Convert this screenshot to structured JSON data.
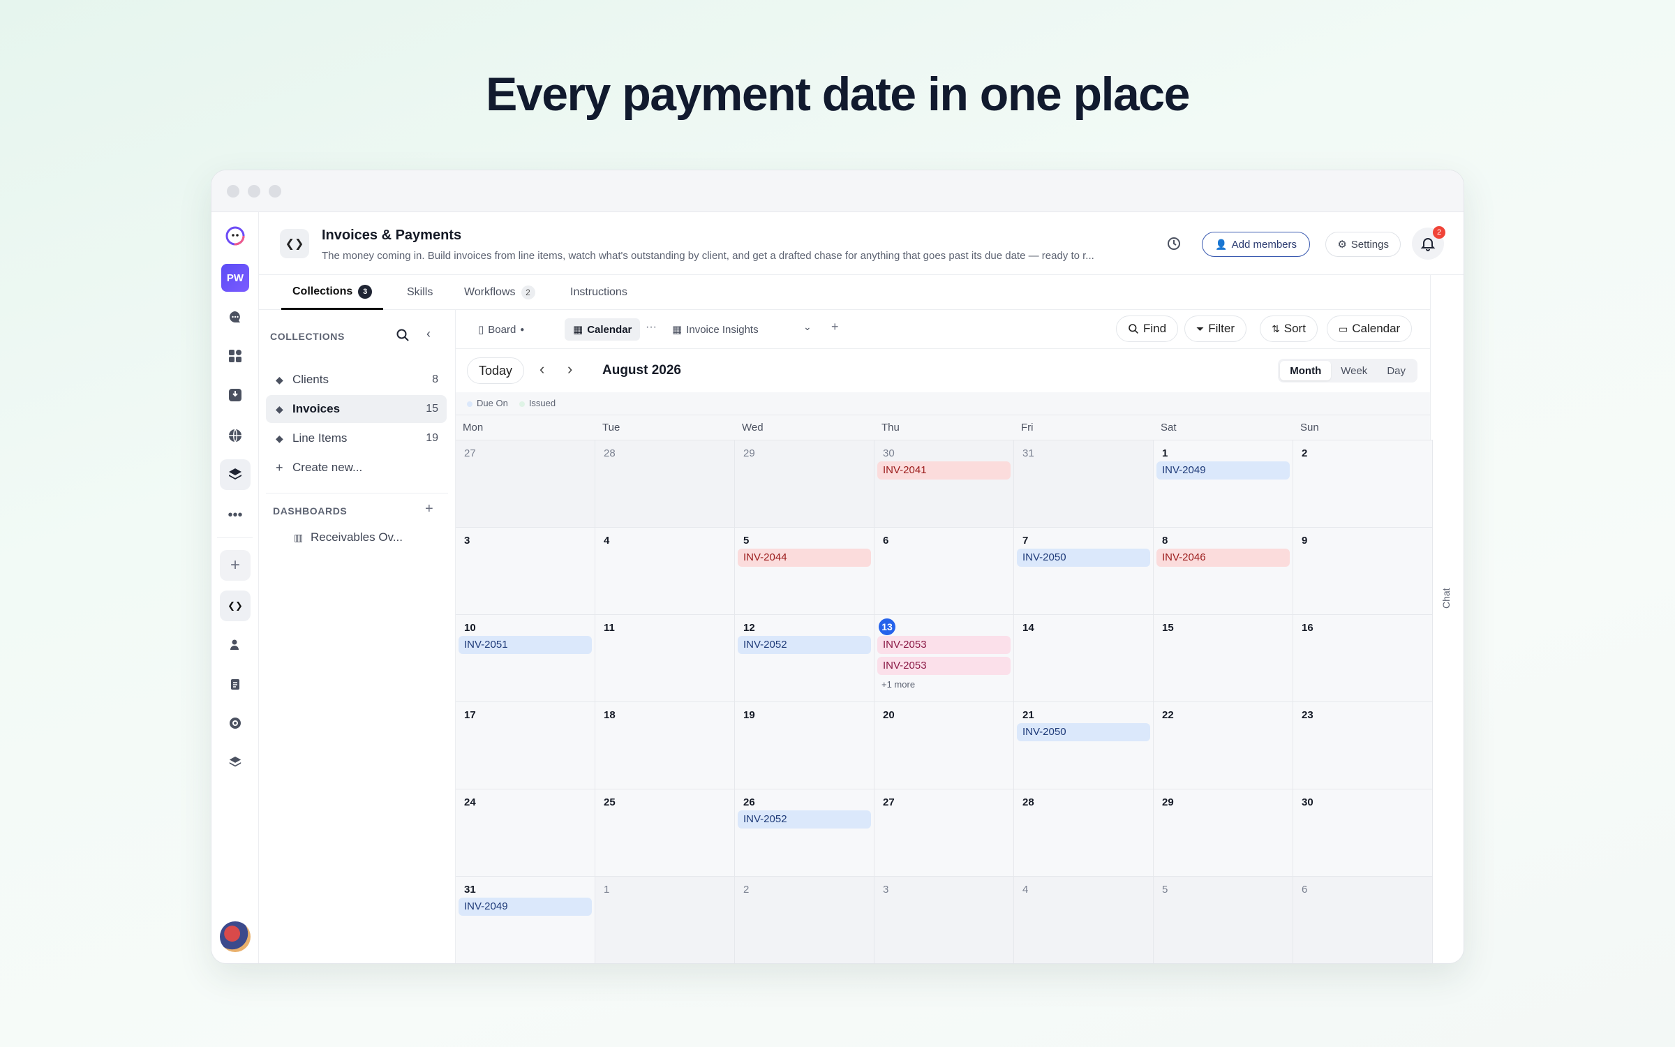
{
  "headline": "Every payment date in one place",
  "app": {
    "title": "Invoices & Payments",
    "description": "The money coming in. Build invoices from line items, watch what's outstanding by client, and get a drafted chase for anything that goes past its due date — ready to r...",
    "workspace_initials": "PW",
    "add_members": "Add members",
    "settings": "Settings",
    "notifications_count": "2",
    "app_icon_glyph": "❮❯"
  },
  "tabs": [
    {
      "label": "Collections",
      "count": "3"
    },
    {
      "label": "Skills"
    },
    {
      "label": "Workflows",
      "count": "2"
    },
    {
      "label": "Instructions"
    }
  ],
  "chat_label": "Chat",
  "panel": {
    "collections_heading": "COLLECTIONS",
    "items": [
      {
        "label": "Clients",
        "count": "8"
      },
      {
        "label": "Invoices",
        "count": "15"
      },
      {
        "label": "Line Items",
        "count": "19"
      }
    ],
    "create_new": "Create new...",
    "dashboards_heading": "DASHBOARDS",
    "dashboard_item": "Receivables Ov..."
  },
  "views": {
    "board": "Board",
    "calendar": "Calendar",
    "insights": "Invoice Insights",
    "find": "Find",
    "filter": "Filter",
    "sort": "Sort",
    "calendar_btn": "Calendar"
  },
  "calendar": {
    "today_label": "Today",
    "month_label": "August 2026",
    "modes": [
      "Month",
      "Week",
      "Day"
    ],
    "active_mode": "Month",
    "legend": [
      {
        "label": "Due On",
        "color": "#dbe8fb"
      },
      {
        "label": "Issued",
        "color": "#dff3e6"
      }
    ],
    "weekdays": [
      "Mon",
      "Tue",
      "Wed",
      "Thu",
      "Fri",
      "Sat",
      "Sun"
    ],
    "weeks": [
      [
        {
          "d": "27",
          "o": true
        },
        {
          "d": "28",
          "o": true
        },
        {
          "d": "29",
          "o": true
        },
        {
          "d": "30",
          "o": true,
          "ev": [
            {
              "t": "INV-2041",
              "c": "red"
            }
          ]
        },
        {
          "d": "31",
          "o": true
        },
        {
          "d": "1",
          "ev": [
            {
              "t": "INV-2049",
              "c": "blue"
            }
          ]
        },
        {
          "d": "2"
        }
      ],
      [
        {
          "d": "3"
        },
        {
          "d": "4"
        },
        {
          "d": "5",
          "ev": [
            {
              "t": "INV-2044",
              "c": "red"
            }
          ]
        },
        {
          "d": "6"
        },
        {
          "d": "7",
          "ev": [
            {
              "t": "INV-2050",
              "c": "blue"
            }
          ]
        },
        {
          "d": "8",
          "ev": [
            {
              "t": "INV-2046",
              "c": "red"
            }
          ]
        },
        {
          "d": "9"
        }
      ],
      [
        {
          "d": "10",
          "ev": [
            {
              "t": "INV-2051",
              "c": "blue"
            }
          ]
        },
        {
          "d": "11"
        },
        {
          "d": "12",
          "ev": [
            {
              "t": "INV-2052",
              "c": "blue"
            }
          ]
        },
        {
          "d": "13",
          "today": true,
          "ev": [
            {
              "t": "INV-2053",
              "c": "pink"
            },
            {
              "t": "INV-2053",
              "c": "pink"
            }
          ],
          "more": "+1 more"
        },
        {
          "d": "14"
        },
        {
          "d": "15"
        },
        {
          "d": "16"
        }
      ],
      [
        {
          "d": "17"
        },
        {
          "d": "18"
        },
        {
          "d": "19"
        },
        {
          "d": "20"
        },
        {
          "d": "21",
          "ev": [
            {
              "t": "INV-2050",
              "c": "blue"
            }
          ]
        },
        {
          "d": "22"
        },
        {
          "d": "23"
        }
      ],
      [
        {
          "d": "24"
        },
        {
          "d": "25"
        },
        {
          "d": "26",
          "ev": [
            {
              "t": "INV-2052",
              "c": "blue"
            }
          ]
        },
        {
          "d": "27"
        },
        {
          "d": "28"
        },
        {
          "d": "29"
        },
        {
          "d": "30"
        }
      ],
      [
        {
          "d": "31",
          "ev": [
            {
              "t": "INV-2049",
              "c": "blue"
            }
          ]
        },
        {
          "d": "1",
          "o": true
        },
        {
          "d": "2",
          "o": true
        },
        {
          "d": "3",
          "o": true
        },
        {
          "d": "4",
          "o": true
        },
        {
          "d": "5",
          "o": true
        },
        {
          "d": "6",
          "o": true
        }
      ]
    ]
  }
}
